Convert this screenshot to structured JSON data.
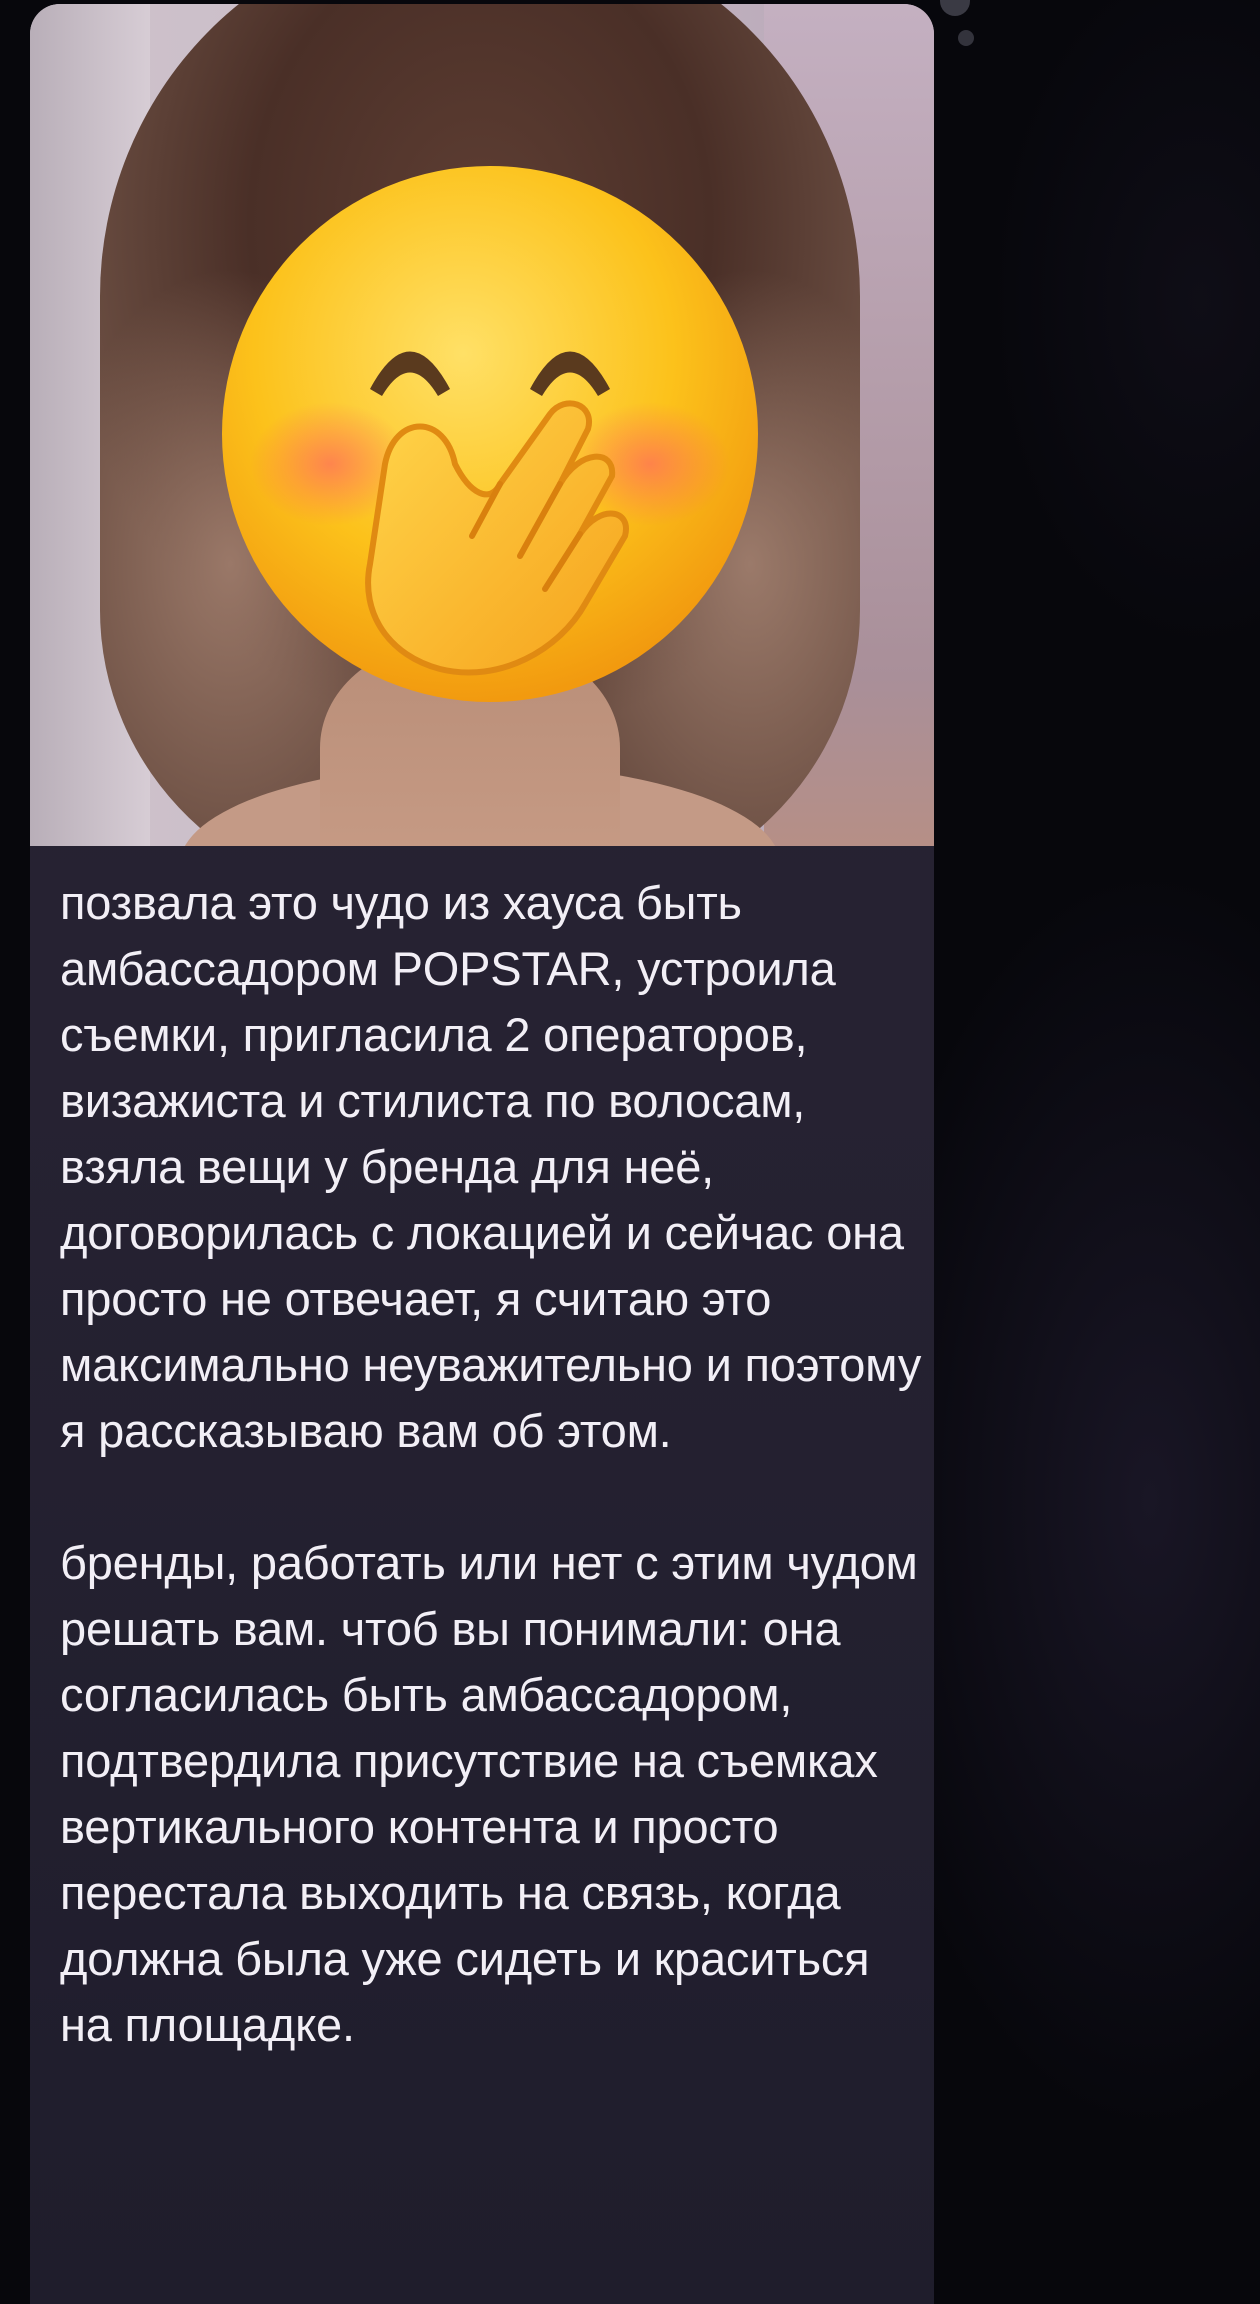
{
  "message": {
    "image_alt_icon": "covering-mouth-face-emoji-icon",
    "text": "позвала это чудо из хауса быть амбассадором POPSTAR, устроила съемки, пригласила 2 операторов, визажиста и стилиста по волосам, взяла вещи у бренда для неё, договорилась с локацией и сейчас она просто не отвечает, я считаю это максимально неуважительно и поэтому я рассказываю вам об этом.\n\nбренды, работать или нет с этим чудом решать вам. чтоб вы понимали: она согласилась быть амбассадором, подтвердила присутствие на съемках вертикального контента и просто перестала выходить на связь, когда должна была уже сидеть и краситься на площадке."
  },
  "colors": {
    "background": "#07070c",
    "bubble": "#262232",
    "text": "#f2eff6"
  }
}
